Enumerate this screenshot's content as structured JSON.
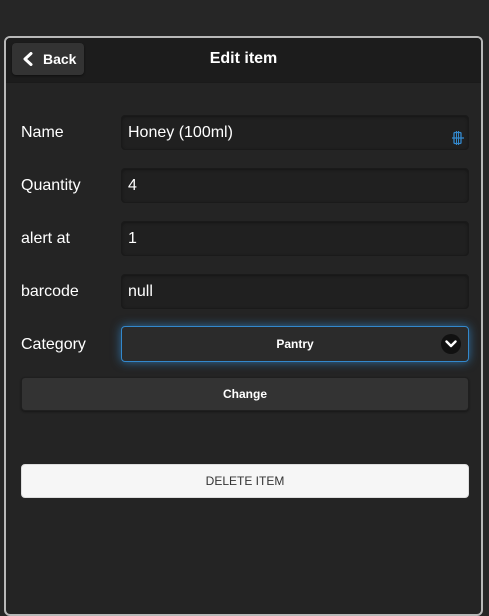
{
  "header": {
    "back_label": "Back",
    "title": "Edit item",
    "back_icon": "chevron-left-icon"
  },
  "form": {
    "name": {
      "label": "Name",
      "value": "Honey (100ml)",
      "icon": "barcode-icon",
      "icon_color": "#3388cc"
    },
    "quantity": {
      "label": "Quantity",
      "value": "4"
    },
    "alert_at": {
      "label": "alert at",
      "value": "1"
    },
    "barcode": {
      "label": "barcode",
      "value": "null"
    },
    "category": {
      "label": "Category",
      "selected": "Pantry",
      "icon": "chevron-down-icon",
      "focus_color": "#3388cc"
    }
  },
  "actions": {
    "change_label": "Change",
    "delete_label": "DELETE ITEM"
  }
}
